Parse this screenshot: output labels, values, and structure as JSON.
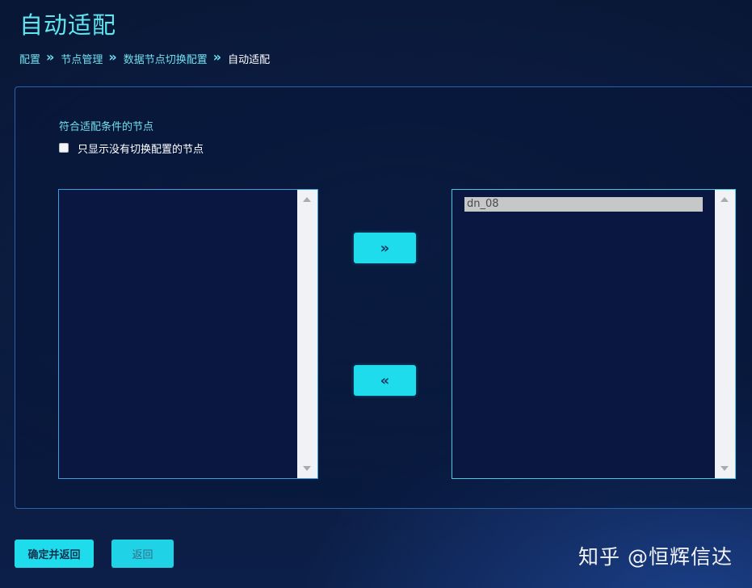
{
  "page": {
    "title": "自动适配"
  },
  "breadcrumb": {
    "items": [
      {
        "label": "配置"
      },
      {
        "label": "节点管理"
      },
      {
        "label": "数据节点切换配置"
      },
      {
        "label": "自动适配"
      }
    ],
    "separator": "»"
  },
  "filter": {
    "section_label": "符合适配条件的节点",
    "checkbox_label": "只显示没有切换配置的节点",
    "checked": false
  },
  "available_list": {
    "items": []
  },
  "selected_list": {
    "items": [
      {
        "label": "dn_08",
        "highlighted": true
      }
    ]
  },
  "transfer": {
    "move_right_label": "»",
    "move_left_label": "«"
  },
  "footer": {
    "confirm_label": "确定并返回",
    "back_label": "返回"
  },
  "watermark": {
    "text": "知乎 @恒辉信达"
  },
  "colors": {
    "accent": "#1fdcec",
    "title": "#5fe6f0",
    "background": "#0a1a3c",
    "border": "#2a64a8",
    "selected_item": "#c6c7c9"
  }
}
